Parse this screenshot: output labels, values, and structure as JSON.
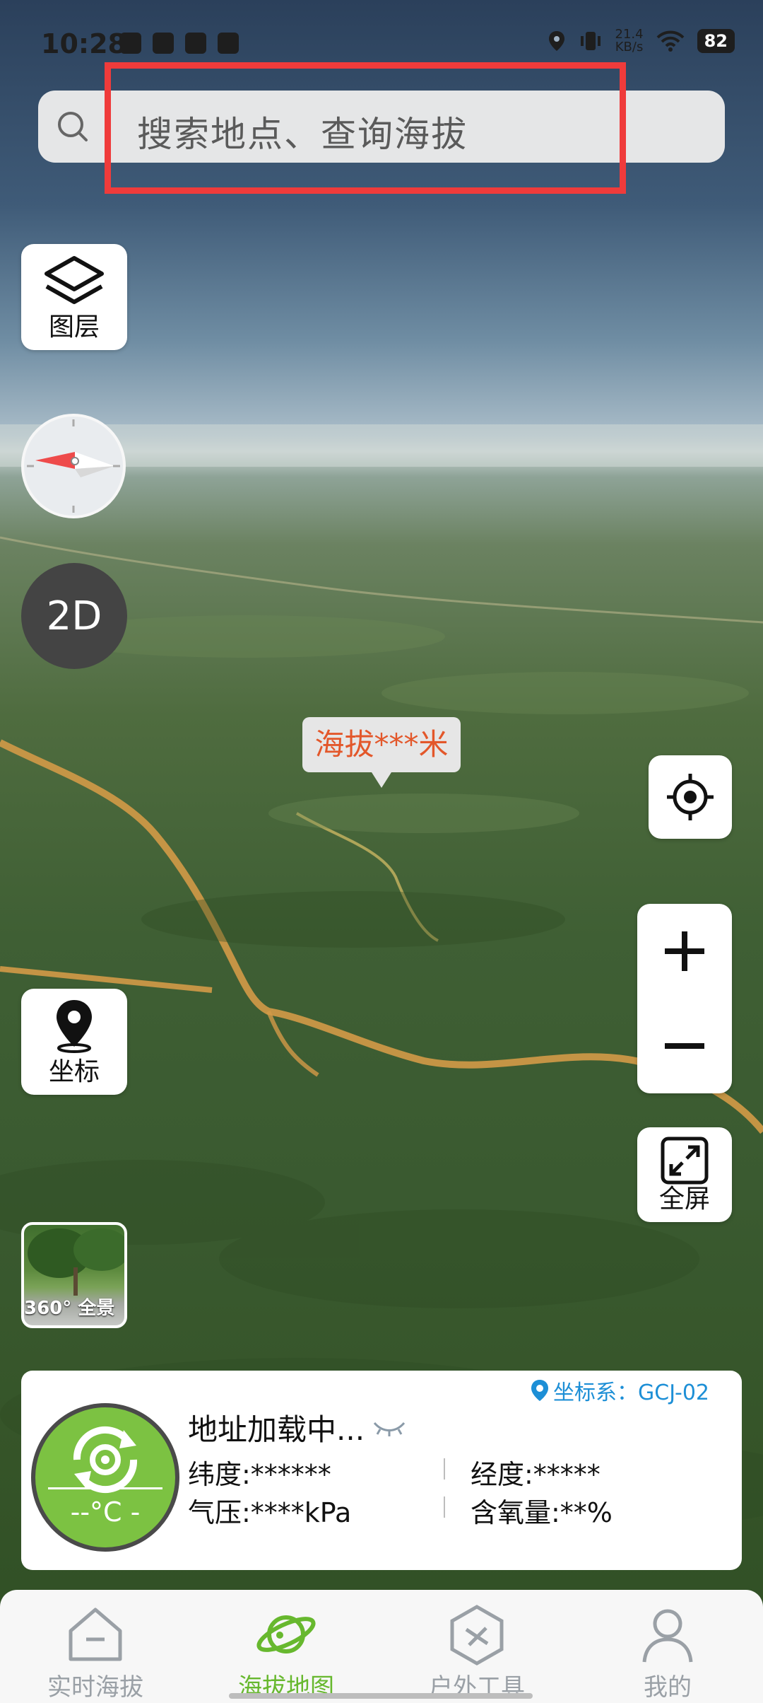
{
  "status_bar": {
    "time": "10:28",
    "net_speed_value": "21.4",
    "net_speed_unit": "KB/s",
    "battery": "82"
  },
  "search": {
    "placeholder": "搜索地点、查询海拔"
  },
  "left_controls": {
    "layers_label": "图层",
    "view_mode_label": "2D",
    "coordinate_label": "坐标",
    "panorama_label": "360° 全景"
  },
  "right_controls": {
    "fullscreen_label": "全屏"
  },
  "map": {
    "elevation_bubble": "海拔***米"
  },
  "info_panel": {
    "coord_system": "坐标系：GCJ-02",
    "address": "地址加载中...",
    "latitude": "纬度:******",
    "longitude": "经度:*****",
    "pressure": "气压:****kPa",
    "oxygen": "含氧量:**%",
    "temperature": "--°C -"
  },
  "bottom_nav": {
    "items": [
      {
        "label": "实时海拔",
        "icon": "home-icon"
      },
      {
        "label": "海拔地图",
        "icon": "planet-icon",
        "active": true
      },
      {
        "label": "户外工具",
        "icon": "tools-hexagon-icon"
      },
      {
        "label": "我的",
        "icon": "user-icon"
      }
    ]
  },
  "colors": {
    "accent_green": "#7cc242",
    "nav_active": "#67b82e",
    "elevation_text": "#e3572a",
    "coord_blue": "#1d8fd6",
    "annotation_red": "#ef3b3b"
  }
}
